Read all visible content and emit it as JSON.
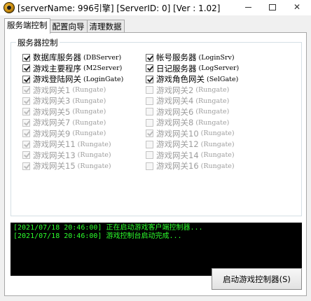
{
  "window": {
    "title": "[serverName: 996引擎] [ServerID: 0] [Ver : 1.02]",
    "icon": "app-logo-icon",
    "controls": [
      "minimize-icon",
      "maximize-icon",
      "close-icon"
    ]
  },
  "tabs": [
    {
      "label": "服务端控制",
      "active": true
    },
    {
      "label": "配置向导",
      "active": false
    },
    {
      "label": "清理数据",
      "active": false
    }
  ],
  "server_group": {
    "legend": "服务器控制",
    "checkboxes": [
      {
        "label": "数据库服务器",
        "sub": "(DBServer)",
        "checked": true,
        "enabled": true
      },
      {
        "label": "帐号服务器",
        "sub": "(LoginSrv)",
        "checked": true,
        "enabled": true
      },
      {
        "label": "游戏主要程序",
        "sub": "(M2Server)",
        "checked": true,
        "enabled": true
      },
      {
        "label": "日记服务器",
        "sub": "(LogServer)",
        "checked": true,
        "enabled": true
      },
      {
        "label": "游戏登陆网关",
        "sub": "(LoginGate)",
        "checked": true,
        "enabled": true
      },
      {
        "label": "游戏角色网关",
        "sub": "(SelGate)",
        "checked": true,
        "enabled": true
      },
      {
        "label": "游戏网关1",
        "sub": "(Rungate)",
        "checked": true,
        "enabled": false
      },
      {
        "label": "游戏网关2",
        "sub": "(Rungate)",
        "checked": false,
        "enabled": false
      },
      {
        "label": "游戏网关3",
        "sub": "(Rungate)",
        "checked": true,
        "enabled": false
      },
      {
        "label": "游戏网关4",
        "sub": "(Rungate)",
        "checked": false,
        "enabled": false
      },
      {
        "label": "游戏网关5",
        "sub": "(Rungate)",
        "checked": true,
        "enabled": false
      },
      {
        "label": "游戏网关6",
        "sub": "(Rungate)",
        "checked": false,
        "enabled": false
      },
      {
        "label": "游戏网关7",
        "sub": "(Rungate)",
        "checked": true,
        "enabled": false
      },
      {
        "label": "游戏网关8",
        "sub": "(Rungate)",
        "checked": false,
        "enabled": false
      },
      {
        "label": "游戏网关9",
        "sub": "(Rungate)",
        "checked": true,
        "enabled": false
      },
      {
        "label": "游戏网关10",
        "sub": "(Rungate)",
        "checked": true,
        "enabled": false
      },
      {
        "label": "游戏网关11",
        "sub": "(Rungate)",
        "checked": true,
        "enabled": false
      },
      {
        "label": "游戏网关12",
        "sub": "(Rungate)",
        "checked": false,
        "enabled": false
      },
      {
        "label": "游戏网关13",
        "sub": "(Rungate)",
        "checked": true,
        "enabled": false
      },
      {
        "label": "游戏网关14",
        "sub": "(Rungate)",
        "checked": false,
        "enabled": false
      },
      {
        "label": "游戏网关15",
        "sub": "(Rungate)",
        "checked": true,
        "enabled": false
      },
      {
        "label": "游戏网关16",
        "sub": "(Rungate)",
        "checked": false,
        "enabled": false
      }
    ]
  },
  "log": {
    "text_color": "#2cff2c",
    "background": "#000000",
    "lines": [
      "[2021/07/18 20:46:00] 正在启动游戏客户端控制器...",
      "[2021/07/18 20:46:00] 游戏控制台启动完成..."
    ]
  },
  "start_button": {
    "label": "启动游戏控制器(S)"
  }
}
